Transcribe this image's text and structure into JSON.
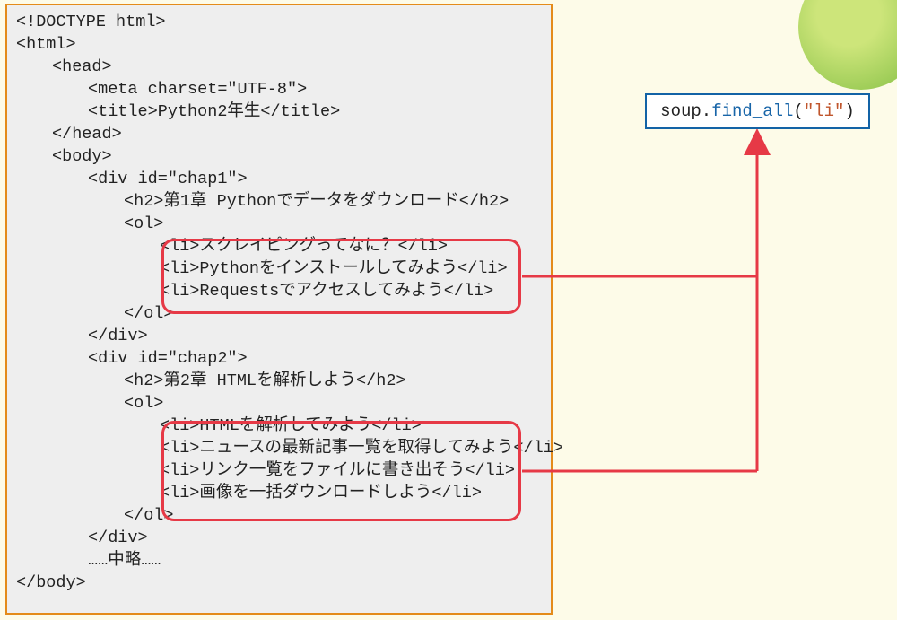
{
  "code": {
    "l01": "<!DOCTYPE html>",
    "l02": "<html>",
    "l03": "<head>",
    "l04": "<meta charset=\"UTF-8\">",
    "l05": "<title>Python2年生</title>",
    "l06": "</head>",
    "l07": "<body>",
    "l08": "<div id=\"chap1\">",
    "l09": "<h2>第1章 Pythonでデータをダウンロード</h2>",
    "l10": "<ol>",
    "l11": "<li>スクレイピングってなに？</li>",
    "l12": "<li>Pythonをインストールしてみよう</li>",
    "l13": "<li>Requestsでアクセスしてみよう</li>",
    "l14": "</ol>",
    "l15": "</div>",
    "l16": "<div id=\"chap2\">",
    "l17": "<h2>第2章 HTMLを解析しよう</h2>",
    "l18": "<ol>",
    "l19": "<li>HTMLを解析してみよう</li>",
    "l20": "<li>ニュースの最新記事一覧を取得してみよう</li>",
    "l21": "<li>リンク一覧をファイルに書き出そう</li>",
    "l22": "<li>画像を一括ダウンロードしよう</li>",
    "l23": "</ol>",
    "l24": "</div>",
    "l25": "……中略……",
    "l26": "</body>"
  },
  "py": {
    "obj": "soup",
    "dot": ".",
    "func": "find_all",
    "open": "(",
    "arg": "\"li\"",
    "close": ")"
  }
}
